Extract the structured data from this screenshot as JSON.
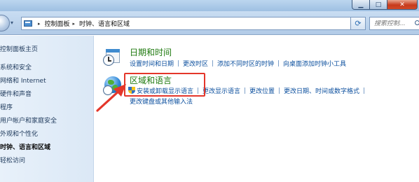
{
  "window": {
    "minimize_glyph": "▁",
    "maximize_glyph": "□",
    "close_glyph": "✕"
  },
  "address_bar": {
    "crumbs": [
      "控制面板",
      "时钟、语言和区域"
    ],
    "separator_glyph": "▸",
    "dropdown_glyph": "▾",
    "refresh_glyph": "⟳"
  },
  "search": {
    "placeholder": "搜索控制..."
  },
  "sidebar": {
    "items": [
      "控制面板主页",
      "系统和安全",
      "网络和 Internet",
      "硬件和声音",
      "程序",
      "用户帐户和家庭安全",
      "外观和个性化",
      "时钟、语言和区域",
      "轻松访问"
    ],
    "current_index": 7
  },
  "categories": [
    {
      "title": "日期和时间",
      "links": [
        "设置时间和日期",
        "更改时区",
        "添加不同时区的时钟",
        "向桌面添加时钟小工具"
      ]
    },
    {
      "title": "区域和语言",
      "links": [
        "安装或卸载显示语言",
        "更改显示语言",
        "更改位置",
        "更改日期、时间或数字格式"
      ],
      "links_line2": [
        "更改键盘或其他输入法"
      ]
    }
  ],
  "colors": {
    "category_title": "#1f7a0f",
    "link": "#0b4f9e",
    "annotation": "#e4362a",
    "sidebar_bg": "#dbe8f6"
  }
}
